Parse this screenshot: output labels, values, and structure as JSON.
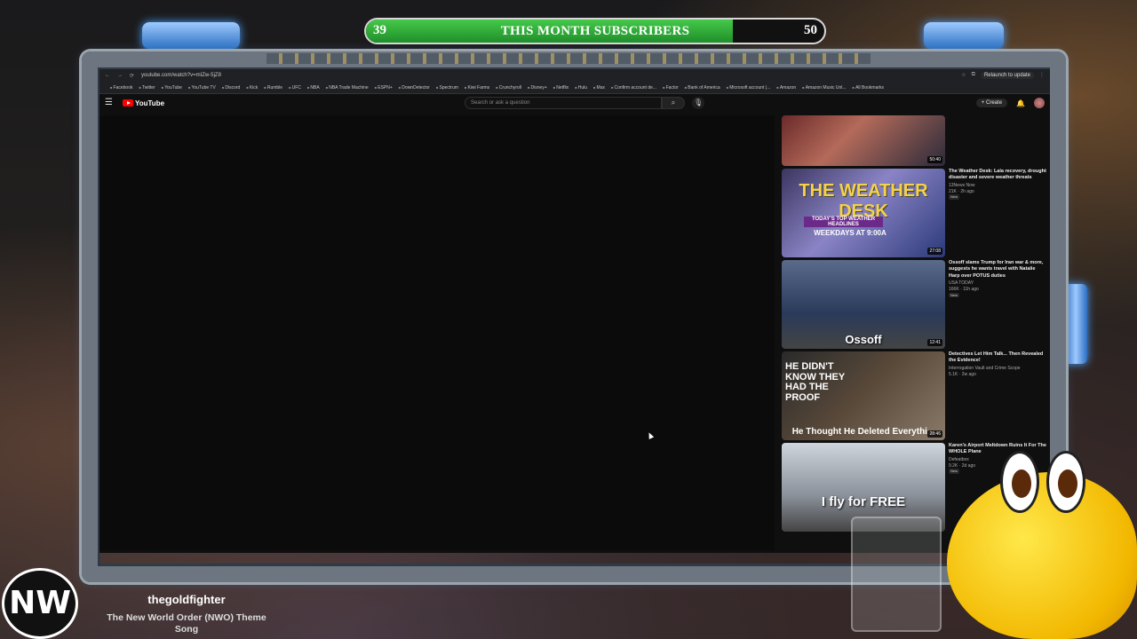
{
  "goal": {
    "start": "39",
    "end": "50",
    "title": "THIS MONTH SUBSCRIBERS",
    "progress_fraction": 0.8
  },
  "browser": {
    "url": "youtube.com/watch?v=mIZw-5jZ8",
    "relaunch_label": "Relaunch to update",
    "bookmarks": [
      "Facebook",
      "Twitter",
      "YouTube",
      "YouTube TV",
      "Discord",
      "Kick",
      "Rumble",
      "UFC",
      "NBA",
      "NBA Trade Machine",
      "ESPN+",
      "DownDetector",
      "Spectrum",
      "Kiwi Farms",
      "Crunchyroll",
      "Disney+",
      "Netflix",
      "Hulu",
      "Max",
      "Confirm account de...",
      "Factor",
      "Bank of America",
      "Microsoft account |...",
      "Amazon",
      "Amazon Music Unl...",
      "All Bookmarks"
    ]
  },
  "youtube": {
    "logo_text": "YouTube",
    "search_placeholder": "Search or ask a question",
    "create_label": "Create",
    "recommendations": [
      {
        "duration": "50:40",
        "title": "",
        "channel": "",
        "stats": "",
        "badge": ""
      },
      {
        "duration": "27:08",
        "title": "The Weather Desk: Lala recovery, drought disaster and severe weather threats",
        "channel": "13News Now",
        "stats": "21K · 2h ago",
        "badge": "New",
        "thumb_text": [
          "THE WEATHER DESK",
          "TODAY'S TOP WEATHER HEADLINES",
          "WEEKDAYS AT 9:00A"
        ]
      },
      {
        "duration": "12:41",
        "title": "Ossoff slams Trump for Iran war & more, suggests he wants travel with Natalie Harp over POTUS duties",
        "channel": "USA TODAY",
        "stats": "166K · 11h ago",
        "badge": "New",
        "thumb_text": [
          "Ossoff"
        ]
      },
      {
        "duration": "28:46",
        "title": "Detectives Let Him Talk... Then Revealed the Evidence!",
        "channel": "Interrogation Vault and Crime Scope",
        "stats": "5.1K · 2w ago",
        "badge": "",
        "thumb_text": [
          "HE DIDN'T KNOW THEY HAD THE PROOF",
          "He Thought He Deleted Everythi..."
        ]
      },
      {
        "duration": "",
        "title": "Karen's Airport Meltdown Ruins It For The WHOLE Plane",
        "channel": "Defeatbox",
        "stats": "9.2K · 2d ago",
        "badge": "New",
        "thumb_text": [
          "I fly for FREE"
        ]
      }
    ]
  },
  "now_playing": {
    "logo_text": "NW",
    "username": "thegoldfighter",
    "song": "The New World Order (NWO) Theme Song"
  }
}
